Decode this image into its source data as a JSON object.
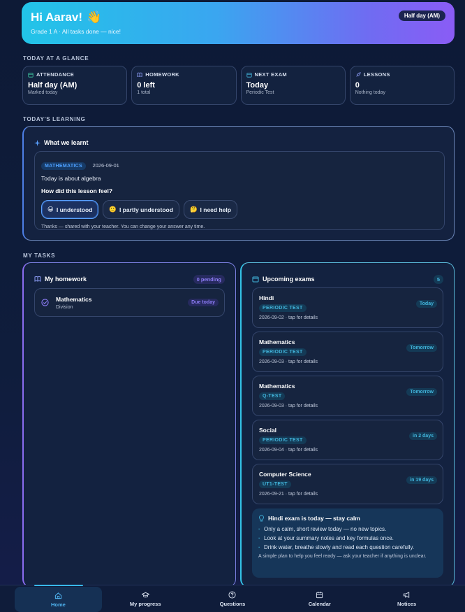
{
  "hero": {
    "greeting": "Hi Aarav!",
    "wave": "👋",
    "subtitle": "Grade 1 A · All tasks done — nice!",
    "status_pill": "Half day (AM)"
  },
  "sections": {
    "glance": "TODAY AT A GLANCE",
    "learning": "TODAY'S LEARNING",
    "tasks": "MY TASKS"
  },
  "glance": [
    {
      "label": "ATTENDANCE",
      "value": "Half day (AM)",
      "sub": "Marked today",
      "icon": "calendar-icon"
    },
    {
      "label": "HOMEWORK",
      "value": "0 left",
      "sub": "1 total",
      "icon": "book-icon"
    },
    {
      "label": "NEXT EXAM",
      "value": "Today",
      "sub": "Periodic Test",
      "icon": "calendar-icon"
    },
    {
      "label": "LESSONS",
      "value": "0",
      "sub": "Nothing today",
      "icon": "rocket-icon"
    }
  ],
  "learning": {
    "title": "What we learnt",
    "subject": "MATHEMATICS",
    "date": "2026-09-01",
    "topic": "Today is about algebra",
    "question": "How did this lesson feel?",
    "options": [
      {
        "emoji": "😀",
        "label": "I understood"
      },
      {
        "emoji": "🙂",
        "label": "I partly understood"
      },
      {
        "emoji": "🤔",
        "label": "I need help"
      }
    ],
    "note": "Thanks — shared with your teacher. You can change your answer any time."
  },
  "homework": {
    "title": "My homework",
    "count": "0 pending",
    "items": [
      {
        "subject": "Mathematics",
        "desc": "Division",
        "due": "Due today"
      }
    ]
  },
  "exams": {
    "title": "Upcoming exams",
    "count": "5",
    "items": [
      {
        "subject": "Hindi",
        "type": "PERIODIC TEST",
        "meta": "2026-09-02 · tap for details",
        "when": "Today"
      },
      {
        "subject": "Mathematics",
        "type": "PERIODIC TEST",
        "meta": "2026-09-03 · tap for details",
        "when": "Tomorrow"
      },
      {
        "subject": "Mathematics",
        "type": "Q-TEST",
        "meta": "2026-09-03 · tap for details",
        "when": "Tomorrow"
      },
      {
        "subject": "Social",
        "type": "PERIODIC TEST",
        "meta": "2026-09-04 · tap for details",
        "when": "in 2 days"
      },
      {
        "subject": "Computer Science",
        "type": "UT1-TEST",
        "meta": "2026-09-21 · tap for details",
        "when": "in 19 days"
      }
    ],
    "tip": {
      "title": "Hindi exam is today — stay calm",
      "points": [
        "Only a calm, short review today — no new topics.",
        "Look at your summary notes and key formulas once.",
        "Drink water, breathe slowly and read each question carefully."
      ],
      "note": "A simple plan to help you feel ready — ask your teacher if anything is unclear."
    }
  },
  "nav": [
    {
      "label": "Home",
      "icon": "home-icon"
    },
    {
      "label": "My progress",
      "icon": "graduation-cap-icon"
    },
    {
      "label": "Questions",
      "icon": "question-icon"
    },
    {
      "label": "Calendar",
      "icon": "calendar-icon"
    },
    {
      "label": "Notices",
      "icon": "megaphone-icon"
    }
  ],
  "colors": {
    "accent": "#38b9ec",
    "violet": "#8c7cf4",
    "background": "#0d1a36"
  }
}
